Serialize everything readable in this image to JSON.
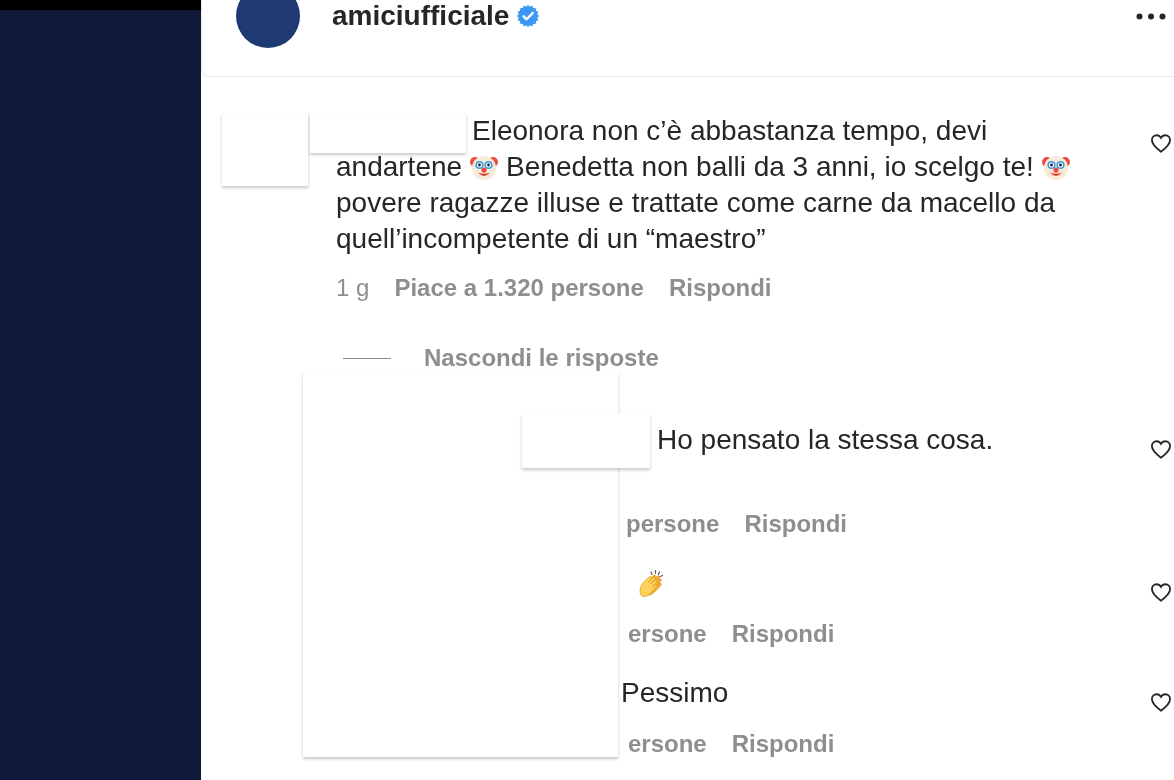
{
  "post_header": {
    "username": "amiciufficiale",
    "verified": true
  },
  "comment": {
    "author_hidden": true,
    "text_lines": [
      [
        {
          "kind": "text",
          "text": "Eleonora non c’è abbastanza tempo, devi"
        }
      ],
      [
        {
          "kind": "text",
          "text": "andartene"
        },
        {
          "kind": "clown"
        },
        {
          "kind": "text",
          "text": "Benedetta non balli da 3 anni, io scelgo te!"
        },
        {
          "kind": "clown"
        }
      ],
      [
        {
          "kind": "text",
          "text": "povere ragazze illuse e trattate come carne da macello da"
        }
      ],
      [
        {
          "kind": "text",
          "text": "quell’incompetente di un “maestro”"
        }
      ]
    ],
    "liked": false,
    "age": "1 g",
    "likes": "Piace a 1.320 persone",
    "reply_action": "Rispondi"
  },
  "replies": {
    "toggle": "Nascondi le risposte",
    "authors_hidden": true,
    "items": [
      {
        "text_parts": [
          {
            "kind": "text",
            "text": "Ho pensato la stessa cosa."
          }
        ],
        "liked": false,
        "likes": "persone",
        "reply_action": "Rispondi"
      },
      {
        "text_parts": [
          {
            "kind": "clap"
          }
        ],
        "liked": false,
        "likes": "ersone",
        "reply_action": "Rispondi"
      },
      {
        "text_parts": [
          {
            "kind": "text",
            "text": "Pessimo"
          }
        ],
        "liked": false,
        "likes": "ersone",
        "reply_action": "Rispondi"
      }
    ]
  }
}
